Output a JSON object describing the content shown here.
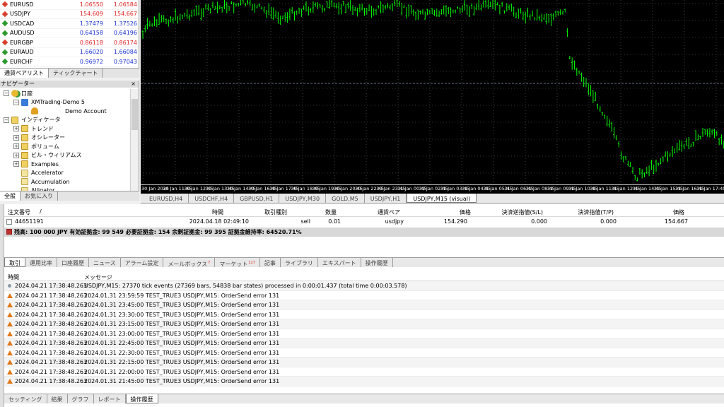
{
  "market_watch": {
    "rows": [
      {
        "symbol": "EURUSD",
        "bid": "1.06550",
        "ask": "1.06584",
        "dir": "down"
      },
      {
        "symbol": "USDJPY",
        "bid": "154.609",
        "ask": "154.667",
        "dir": "down"
      },
      {
        "symbol": "USDCAD",
        "bid": "1.37479",
        "ask": "1.37526",
        "dir": "up"
      },
      {
        "symbol": "AUDUSD",
        "bid": "0.64158",
        "ask": "0.64196",
        "dir": "up"
      },
      {
        "symbol": "EURGBP",
        "bid": "0.86118",
        "ask": "0.86174",
        "dir": "down"
      },
      {
        "symbol": "EURAUD",
        "bid": "1.66020",
        "ask": "1.66084",
        "dir": "up"
      },
      {
        "symbol": "EURCHF",
        "bid": "0.96972",
        "ask": "0.97043",
        "dir": "up"
      }
    ],
    "tabs": [
      "通貨ペアリスト",
      "ティックチャート"
    ]
  },
  "navigator": {
    "title": "ナビゲーター",
    "close": "×",
    "nodes": [
      {
        "label": "口座",
        "level": 0,
        "pm": "−",
        "icon": "account-icon"
      },
      {
        "label": "XMTrading-Demo 5",
        "level": 1,
        "pm": "−",
        "icon": "server-icon"
      },
      {
        "label": "Demo Account",
        "level": 2,
        "pm": "",
        "icon": "user-icon"
      },
      {
        "label": "インディケータ",
        "level": 0,
        "pm": "−",
        "icon": "indicator-folder-icon"
      },
      {
        "label": "トレンド",
        "level": 1,
        "pm": "+",
        "icon": "folder-icon"
      },
      {
        "label": "オシレーター",
        "level": 1,
        "pm": "+",
        "icon": "folder-icon"
      },
      {
        "label": "ボリューム",
        "level": 1,
        "pm": "+",
        "icon": "folder-icon"
      },
      {
        "label": "ビル・ウィリアムス",
        "level": 1,
        "pm": "+",
        "icon": "folder-icon"
      },
      {
        "label": "Examples",
        "level": 1,
        "pm": "+",
        "icon": "folder-icon"
      },
      {
        "label": "Accelerator",
        "level": 1,
        "pm": "",
        "icon": "indicator-icon"
      },
      {
        "label": "Accumulation",
        "level": 1,
        "pm": "",
        "icon": "indicator-icon"
      },
      {
        "label": "Alligator",
        "level": 1,
        "pm": "",
        "icon": "indicator-icon"
      }
    ],
    "tabs": [
      "全般",
      "お気に入り"
    ]
  },
  "chart": {
    "time_labels": [
      "30 Jan 2024",
      "30 Jan 11:45",
      "30 Jan 12:45",
      "30 Jan 13:45",
      "30 Jan 14:45",
      "30 Jan 16:45",
      "30 Jan 17:45",
      "30 Jan 18:45",
      "30 Jan 19:45",
      "30 Jan 20:45",
      "30 Jan 22:45",
      "30 Jan 23:45",
      "31 Jan 00:45",
      "31 Jan 02:45",
      "31 Jan 03:45",
      "31 Jan 04:45",
      "31 Jan 05:45",
      "31 Jan 06:45",
      "31 Jan 08:45",
      "31 Jan 09:45",
      "31 Jan 10:45",
      "31 Jan 11:45",
      "31 Jan 12:45",
      "31 Jan 14:45",
      "31 Jan 15:45",
      "31 Jan 16:45",
      "31 Jan 17:45"
    ],
    "tabs": [
      "EURUSD,H4",
      "USDCHF,H4",
      "GBPUSD,H1",
      "USDJPY,M30",
      "GOLD,M5",
      "USDJPY,H1",
      "USDJPY,M15 (visual)"
    ],
    "active_tab": 6,
    "candle_color": "#00ff00",
    "background": "#000000"
  },
  "trade": {
    "headers": [
      "注文番号",
      "/",
      "時間",
      "取引種別",
      "数量",
      "通貨ペア",
      "価格",
      "決済逆指値(S/L)",
      "決済指値(T/P)",
      "価格"
    ],
    "row": {
      "ticket": "44651191",
      "time": "2024.04.18 02:49:10",
      "type": "sell",
      "volume": "0.01",
      "symbol": "usdjpy",
      "price": "154.290",
      "sl": "0.000",
      "tp": "0.000",
      "current": "154.667"
    },
    "balance": "残高: 100 000 JPY  有効証拠金: 99 549  必要証拠金: 154  余剰証拠金: 99 395  証拠金維持率: 64520.71%"
  },
  "toolbox_tabs": {
    "items": [
      {
        "label": "取引",
        "count": ""
      },
      {
        "label": "運用比率",
        "count": ""
      },
      {
        "label": "口座履歴",
        "count": ""
      },
      {
        "label": "ニュース",
        "count": ""
      },
      {
        "label": "アラーム設定",
        "count": ""
      },
      {
        "label": "メールボックス",
        "count": "7"
      },
      {
        "label": "マーケット",
        "count": "117"
      },
      {
        "label": "記事",
        "count": ""
      },
      {
        "label": "ライブラリ",
        "count": ""
      },
      {
        "label": "エキスパート",
        "count": ""
      },
      {
        "label": "操作履歴",
        "count": ""
      }
    ],
    "active": 0
  },
  "log": {
    "headers": {
      "time": "時間",
      "message": "メッセージ"
    },
    "rows": [
      {
        "level": "info",
        "time": "2024.04.21 17:38:48.263",
        "message": "USDJPY,M15: 27370 tick events (27369 bars, 54838 bar states) processed in 0:00:01.437 (total time 0:00:03.578)"
      },
      {
        "level": "warn",
        "time": "2024.04.21 17:38:48.263",
        "message": "2024.01.31 23:59:59  TEST_TRUE3 USDJPY,M15: OrderSend error 131"
      },
      {
        "level": "warn",
        "time": "2024.04.21 17:38:48.263",
        "message": "2024.01.31 23:45:00  TEST_TRUE3 USDJPY,M15: OrderSend error 131"
      },
      {
        "level": "warn",
        "time": "2024.04.21 17:38:48.263",
        "message": "2024.01.31 23:30:00  TEST_TRUE3 USDJPY,M15: OrderSend error 131"
      },
      {
        "level": "warn",
        "time": "2024.04.21 17:38:48.263",
        "message": "2024.01.31 23:15:00  TEST_TRUE3 USDJPY,M15: OrderSend error 131"
      },
      {
        "level": "warn",
        "time": "2024.04.21 17:38:48.263",
        "message": "2024.01.31 23:00:00  TEST_TRUE3 USDJPY,M15: OrderSend error 131"
      },
      {
        "level": "warn",
        "time": "2024.04.21 17:38:48.263",
        "message": "2024.01.31 22:45:00  TEST_TRUE3 USDJPY,M15: OrderSend error 131"
      },
      {
        "level": "warn",
        "time": "2024.04.21 17:38:48.263",
        "message": "2024.01.31 22:30:00  TEST_TRUE3 USDJPY,M15: OrderSend error 131"
      },
      {
        "level": "warn",
        "time": "2024.04.21 17:38:48.263",
        "message": "2024.01.31 22:15:00  TEST_TRUE3 USDJPY,M15: OrderSend error 131"
      },
      {
        "level": "warn",
        "time": "2024.04.21 17:38:48.263",
        "message": "2024.01.31 22:00:00  TEST_TRUE3 USDJPY,M15: OrderSend error 131"
      },
      {
        "level": "warn",
        "time": "2024.04.21 17:38:48.263",
        "message": "2024.01.31 21:45:00  TEST_TRUE3 USDJPY,M15: OrderSend error 131"
      }
    ]
  },
  "tester_tabs": {
    "items": [
      "セッティング",
      "結果",
      "グラフ",
      "レポート",
      "操作履歴"
    ],
    "active": 4
  }
}
